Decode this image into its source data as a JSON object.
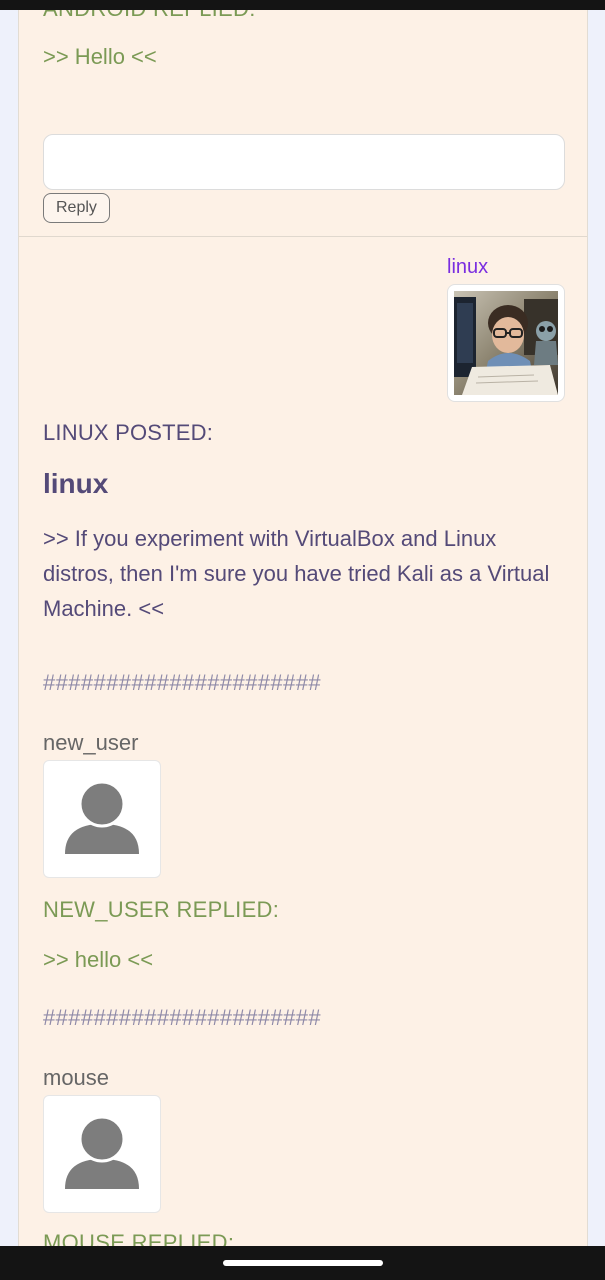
{
  "top_reply": {
    "header": "ANDROID REPLIED:",
    "body": ">> Hello <<"
  },
  "reply_form": {
    "input_value": "",
    "button_label": "Reply"
  },
  "post": {
    "author": "linux",
    "posted_label": "LINUX POSTED:",
    "title": "linux",
    "body": ">> If you experiment with VirtualBox and Linux distros, then I'm sure you have tried Kali as a Virtual Machine. <<"
  },
  "replies": [
    {
      "separator": "######################",
      "username": "new_user",
      "header": "NEW_USER REPLIED:",
      "body": ">> hello <<"
    },
    {
      "separator": "######################",
      "username": "mouse",
      "header": "MOUSE REPLIED:"
    }
  ],
  "icons": {
    "author_avatar": "child-at-computer-image",
    "default_avatar": "person-placeholder-icon"
  },
  "colors": {
    "card_bg": "#fdf1e6",
    "reply_green": "#7b9a55",
    "post_text": "#544a78",
    "author_link": "#7a2ee0"
  }
}
